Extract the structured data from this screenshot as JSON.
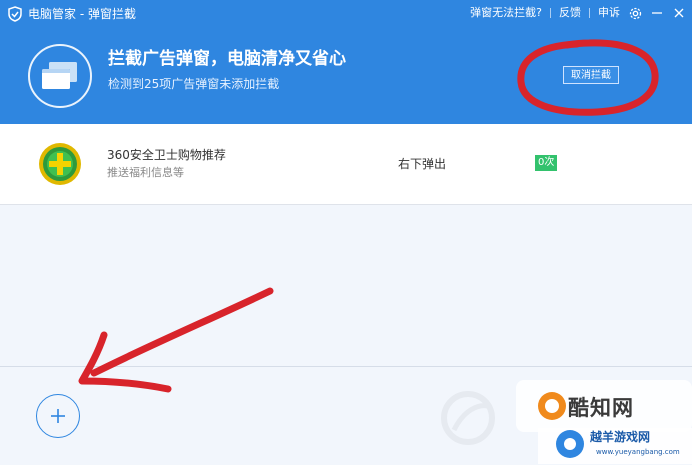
{
  "titlebar": {
    "title": "电脑管家 - 弹窗拦截",
    "link_cannot_block": "弹窗无法拦截?",
    "link_feedback": "反馈",
    "link_complain": "申诉"
  },
  "header": {
    "headline": "拦截广告弹窗，电脑清净又省心",
    "subline": "检测到25项广告弹窗未添加拦截",
    "cancel_label": "取消拦截"
  },
  "list": {
    "items": [
      {
        "name": "360安全卫士购物推荐",
        "desc": "推送福利信息等",
        "position": "右下弹出",
        "count": "0次"
      }
    ]
  },
  "watermark": {
    "text1": "酷知网",
    "text2": "越羊游戏网",
    "text3": "www.yueyangbang.com"
  },
  "colors": {
    "accent": "#2f86e0",
    "annotation": "#d8242b",
    "badge": "#33c26d"
  }
}
